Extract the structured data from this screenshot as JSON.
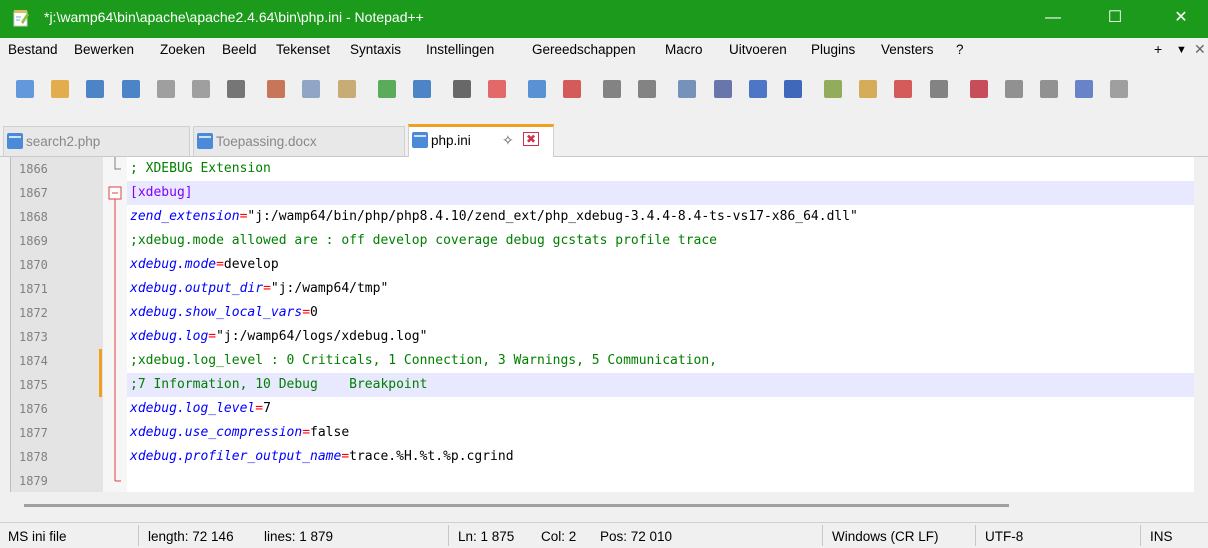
{
  "window": {
    "title": "*j:\\wamp64\\bin\\apache\\apache2.4.64\\bin\\php.ini - Notepad++",
    "titlebar_color": "#1c9a1c",
    "minimize_glyph": "—",
    "maximize_glyph": "☐",
    "close_glyph": "✕"
  },
  "menu": {
    "items": [
      "Bestand",
      "Bewerken",
      "Zoeken",
      "Beeld",
      "Tekenset",
      "Syntaxis",
      "Instellingen",
      "Gereedschappen",
      "Macro",
      "Uitvoeren",
      "Plugins",
      "Vensters",
      "?"
    ],
    "plus_glyph": "+",
    "down_glyph": "▼",
    "close_glyph": "✕"
  },
  "toolbar": {
    "icons": [
      "new-file-icon",
      "open-file-icon",
      "save-icon",
      "save-all-icon",
      "close-icon",
      "close-all-icon",
      "print-icon",
      "cut-icon",
      "copy-icon",
      "paste-icon",
      "undo-icon",
      "redo-icon",
      "find-icon",
      "replace-icon",
      "zoom-in-icon",
      "zoom-out-icon",
      "sync-vertical-icon",
      "sync-horizontal-icon",
      "word-wrap-icon",
      "show-all-chars-icon",
      "indent-guide-icon",
      "language-icon",
      "doc-map-icon",
      "function-list-icon",
      "folder-workspace-icon",
      "monitoring-icon",
      "record-macro-icon",
      "stop-record-icon",
      "playback-macro-icon",
      "run-macro-multiple-icon",
      "save-macro-icon"
    ]
  },
  "tabs": [
    {
      "label": "search2.php",
      "active": false
    },
    {
      "label": "Toepassing.docx",
      "active": false
    },
    {
      "label": "php.ini",
      "active": true,
      "pin_glyph": "✧",
      "close_glyph": "✖"
    }
  ],
  "editor": {
    "lines": [
      {
        "num": "1866",
        "tokens": [
          {
            "t": "; XDEBUG Extension",
            "c": "c-cm"
          }
        ]
      },
      {
        "num": "1867",
        "tokens": [
          {
            "t": "[xdebug]",
            "c": "c-sec"
          }
        ],
        "fold": "box"
      },
      {
        "num": "1868",
        "tokens": [
          {
            "t": "zend_extension",
            "c": "c-key"
          },
          {
            "t": "=",
            "c": "c-eq"
          },
          {
            "t": "\"j:/wamp64/bin/php/php8.4.10/zend_ext/php_xdebug-3.4.4-8.4-ts-vs17-x86_64.dll\"",
            "c": "c-val"
          }
        ]
      },
      {
        "num": "1869",
        "tokens": [
          {
            "t": ";xdebug.mode allowed are : off develop coverage debug gcstats profile trace",
            "c": "c-cm"
          }
        ]
      },
      {
        "num": "1870",
        "tokens": [
          {
            "t": "xdebug.mode",
            "c": "c-key"
          },
          {
            "t": "=",
            "c": "c-eq"
          },
          {
            "t": "develop",
            "c": "c-val"
          }
        ]
      },
      {
        "num": "1871",
        "tokens": [
          {
            "t": "xdebug.output_dir",
            "c": "c-key"
          },
          {
            "t": "=",
            "c": "c-eq"
          },
          {
            "t": "\"j:/wamp64/tmp\"",
            "c": "c-val"
          }
        ]
      },
      {
        "num": "1872",
        "tokens": [
          {
            "t": "xdebug.show_local_vars",
            "c": "c-key"
          },
          {
            "t": "=",
            "c": "c-eq"
          },
          {
            "t": "0",
            "c": "c-val"
          }
        ]
      },
      {
        "num": "1873",
        "tokens": [
          {
            "t": "xdebug.log",
            "c": "c-key"
          },
          {
            "t": "=",
            "c": "c-eq"
          },
          {
            "t": "\"j:/wamp64/logs/xdebug.log\"",
            "c": "c-val"
          }
        ]
      },
      {
        "num": "1874",
        "tokens": [
          {
            "t": ";xdebug.log_level : 0 Criticals, 1 Connection, 3 Warnings, 5 Communication,",
            "c": "c-cm"
          }
        ],
        "changed": true
      },
      {
        "num": "1875",
        "tokens": [
          {
            "t": ";7 Information, 10 Debug    Breakpoint",
            "c": "c-cm"
          }
        ],
        "changed": true,
        "current": true
      },
      {
        "num": "1876",
        "tokens": [
          {
            "t": "xdebug.log_level",
            "c": "c-key"
          },
          {
            "t": "=",
            "c": "c-eq"
          },
          {
            "t": "7",
            "c": "c-val"
          }
        ]
      },
      {
        "num": "1877",
        "tokens": [
          {
            "t": "xdebug.use_compression",
            "c": "c-key"
          },
          {
            "t": "=",
            "c": "c-eq"
          },
          {
            "t": "false",
            "c": "c-val"
          }
        ]
      },
      {
        "num": "1878",
        "tokens": [
          {
            "t": "xdebug.profiler_output_name",
            "c": "c-key"
          },
          {
            "t": "=",
            "c": "c-eq"
          },
          {
            "t": "trace.%H.%t.%p.cgrind",
            "c": "c-val"
          }
        ]
      },
      {
        "num": "1879",
        "tokens": [],
        "fold": "end"
      }
    ]
  },
  "status": {
    "language": "MS ini file",
    "length": "length: 72 146",
    "lines": "lines: 1 879",
    "ln": "Ln: 1 875",
    "col": "Col: 2",
    "pos": "Pos: 72 010",
    "eol": "Windows (CR LF)",
    "encoding": "UTF-8",
    "mode": "INS"
  }
}
